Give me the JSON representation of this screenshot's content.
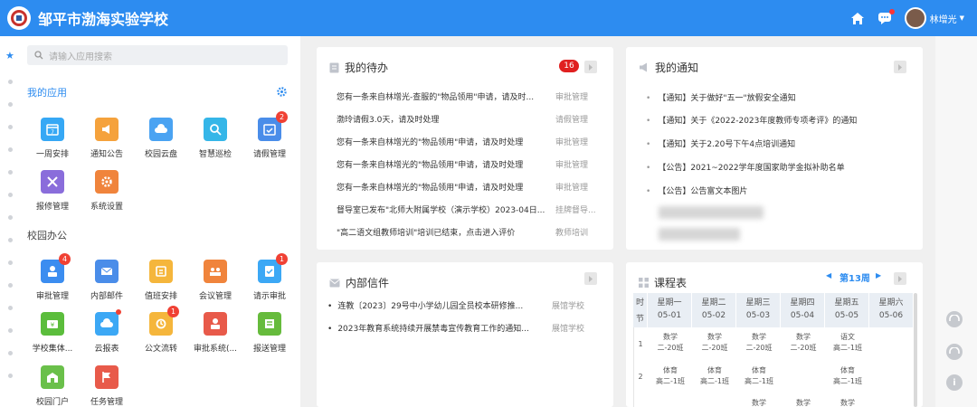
{
  "header": {
    "school_name": "邹平市渤海实验学校",
    "user_name": "林增光",
    "icons": [
      "home-icon",
      "message-icon",
      "avatar"
    ],
    "accent": "#2d8cf0"
  },
  "sidebar": {
    "search_placeholder": "请输入应用搜索",
    "my_apps_title": "我的应用",
    "my_apps": [
      {
        "label": "一周安排",
        "icon": "calendar-icon",
        "color": "#36a8f5",
        "badge": null
      },
      {
        "label": "通知公告",
        "icon": "megaphone-icon",
        "color": "#f5a23c",
        "badge": null
      },
      {
        "label": "校园云盘",
        "icon": "cloud-icon",
        "color": "#4aa3f2",
        "badge": null
      },
      {
        "label": "智慧巡检",
        "icon": "inspect-icon",
        "color": "#35b6e8",
        "badge": null
      },
      {
        "label": "请假管理",
        "icon": "leave-icon",
        "color": "#4a8de9",
        "badge": "2"
      },
      {
        "label": "报修管理",
        "icon": "tools-icon",
        "color": "#8a6ddb",
        "badge": null
      },
      {
        "label": "系统设置",
        "icon": "settings-icon",
        "color": "#f0843c",
        "badge": null
      }
    ],
    "office_title": "校园办公",
    "office_apps": [
      {
        "label": "审批管理",
        "icon": "approve-icon",
        "color": "#3b8df0",
        "badge": "4"
      },
      {
        "label": "内部邮件",
        "icon": "mail-icon",
        "color": "#4a8de9",
        "badge": null
      },
      {
        "label": "值班安排",
        "icon": "duty-icon",
        "color": "#f5b63c",
        "badge": null
      },
      {
        "label": "会议管理",
        "icon": "meeting-icon",
        "color": "#f0843c",
        "badge": null
      },
      {
        "label": "请示审批",
        "icon": "request-icon",
        "color": "#3ca8f5",
        "badge": "1"
      },
      {
        "label": "学校集体...",
        "icon": "group-icon",
        "color": "#5bbd3c",
        "badge": null
      },
      {
        "label": "云报表",
        "icon": "report-icon",
        "color": "#3ca8f5",
        "badge": "dot"
      },
      {
        "label": "公文流转",
        "icon": "doc-icon",
        "color": "#f5b63c",
        "badge": "1"
      },
      {
        "label": "审批系统(...",
        "icon": "approve-system-icon",
        "color": "#e85a4a",
        "badge": null
      },
      {
        "label": "报送管理",
        "icon": "submit-icon",
        "color": "#66bb3c",
        "badge": null
      },
      {
        "label": "校园门户",
        "icon": "portal-icon",
        "color": "#6ac04a",
        "badge": null
      },
      {
        "label": "任务管理",
        "icon": "flag-icon",
        "color": "#e85a4a",
        "badge": null
      }
    ]
  },
  "todo": {
    "title": "我的待办",
    "count": "16",
    "items": [
      {
        "text": "您有一条来自林增光-查服的\"物品领用\"申请，请及时...",
        "cat": "审批管理"
      },
      {
        "text": "渤玲请假3.0天，请及时处理",
        "cat": "请假管理"
      },
      {
        "text": "您有一条来自林增光的\"物品领用\"申请，请及时处理",
        "cat": "审批管理"
      },
      {
        "text": "您有一条来自林增光的\"物品领用\"申请，请及时处理",
        "cat": "审批管理"
      },
      {
        "text": "您有一条来自林增光的\"物品领用\"申请，请及时处理",
        "cat": "审批管理"
      },
      {
        "text": "督导室已发布\"北师大附属学校（演示学校）2023-04日...",
        "cat": "挂牌督导..."
      },
      {
        "text": "\"高二语文组教师培训\"培训已结束，点击进入评价",
        "cat": "教师培训"
      }
    ]
  },
  "notices": {
    "title": "我的通知",
    "items": [
      "【通知】关于做好\"五一\"放假安全通知",
      "【通知】关于《2022-2023年度教师专项考评》的通知",
      "【通知】关于2.20号下午4点培训通知",
      "【公告】2021~2022学年度国家助学金拟补助名单",
      "【公告】公告富文本图片"
    ]
  },
  "mail": {
    "title": "内部信件",
    "items": [
      {
        "text": "连教〔2023〕29号中小学幼儿园全员校本研修推...",
        "sender": "展馆学校"
      },
      {
        "text": "2023年教育系统持续开展禁毒宣传教育工作的通知...",
        "sender": "展馆学校"
      }
    ]
  },
  "timetable": {
    "title": "课程表",
    "week": "第13周",
    "col_time_top": "时",
    "col_time_bottom": "节",
    "days": [
      {
        "name": "星期一",
        "date": "05-01"
      },
      {
        "name": "星期二",
        "date": "05-02"
      },
      {
        "name": "星期三",
        "date": "05-03"
      },
      {
        "name": "星期四",
        "date": "05-04"
      },
      {
        "name": "星期五",
        "date": "05-05"
      },
      {
        "name": "星期六",
        "date": "05-06"
      }
    ],
    "periods": [
      "1",
      "2"
    ],
    "rows": [
      [
        {
          "s": "数学",
          "c": "二-20班"
        },
        {
          "s": "数学",
          "c": "二-20班"
        },
        {
          "s": "数学",
          "c": "二-20班"
        },
        {
          "s": "数学",
          "c": "二-20班"
        },
        {
          "s": "语文",
          "c": "高二-1班"
        },
        null
      ],
      [
        {
          "s": "体育",
          "c": "高二-1班"
        },
        {
          "s": "体育",
          "c": "高二-1班"
        },
        {
          "s": "体育",
          "c": "高二-1班"
        },
        null,
        {
          "s": "体育",
          "c": "高二-1班"
        },
        null
      ],
      [
        null,
        null,
        {
          "s": "数学",
          "c": ""
        },
        {
          "s": "数学",
          "c": ""
        },
        {
          "s": "数学",
          "c": ""
        },
        null
      ]
    ]
  }
}
